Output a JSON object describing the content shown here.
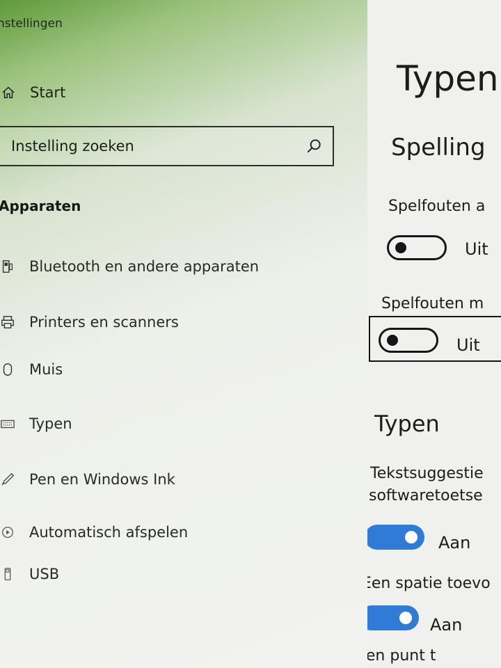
{
  "sidebar": {
    "title": "nstellingen",
    "home_label": "Start",
    "search_placeholder": "Instelling zoeken",
    "section_label": "Apparaten",
    "items": [
      {
        "label": "Bluetooth en andere apparaten",
        "icon": "bluetooth-device-icon"
      },
      {
        "label": "Printers en scanners",
        "icon": "printer-icon"
      },
      {
        "label": "Muis",
        "icon": "mouse-icon"
      },
      {
        "label": "Typen",
        "icon": "keyboard-icon"
      },
      {
        "label": "Pen en Windows Ink",
        "icon": "pen-icon"
      },
      {
        "label": "Automatisch afspelen",
        "icon": "autoplay-icon"
      },
      {
        "label": "USB",
        "icon": "usb-icon"
      }
    ]
  },
  "content": {
    "page_title": "Typen",
    "spelling": {
      "heading": "Spelling",
      "setting1_label": "Spelfouten a",
      "setting1_state": "Uit",
      "setting2_label": "Spelfouten m",
      "setting2_state": "Uit"
    },
    "typing": {
      "heading": "Typen",
      "setting1_label_line1": "Tekstsuggestie",
      "setting1_label_line2": "softwaretoetse",
      "setting1_state": "Aan",
      "setting2_label": "Een spatie toevo",
      "setting2_state": "Aan",
      "setting3_label": "Een punt t"
    }
  },
  "colors": {
    "toggle_on": "#2f7bd6",
    "toggle_off_outline": "#151515",
    "accent_green": "#5f9a3a"
  }
}
